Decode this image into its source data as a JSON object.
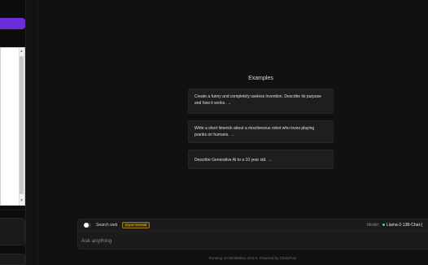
{
  "examples": {
    "title": "Examples",
    "items": [
      {
        "text": "Create a funny and completely useless invention. Describe its purpose and how it works. →"
      },
      {
        "text": "Write a short limerick about a mischievous robot who loves playing pranks on humans. →"
      },
      {
        "text": "Describe Generative AI to a 10 year old. →"
      }
    ]
  },
  "composer": {
    "search_web_label": "Search web",
    "search_web_enabled": false,
    "experimental_badge": "Experimental",
    "model_label": "Model:",
    "model_name": "Llama-2-13B-Chat-(",
    "input_placeholder": "Ask anything",
    "input_value": ""
  },
  "footer": {
    "text": "Running on NimbleBox v3.0.0. Powered by ChainFury"
  },
  "colors": {
    "background": "#111111",
    "accent": "#6a2fd6",
    "badge": "#f0c23a",
    "model_dot": "#39d0a0"
  },
  "icons": {
    "toggle": "toggle-switch",
    "model_status": "status-dot-icon",
    "scroll_up": "chevron-up-icon",
    "scroll_down": "chevron-down-icon"
  }
}
